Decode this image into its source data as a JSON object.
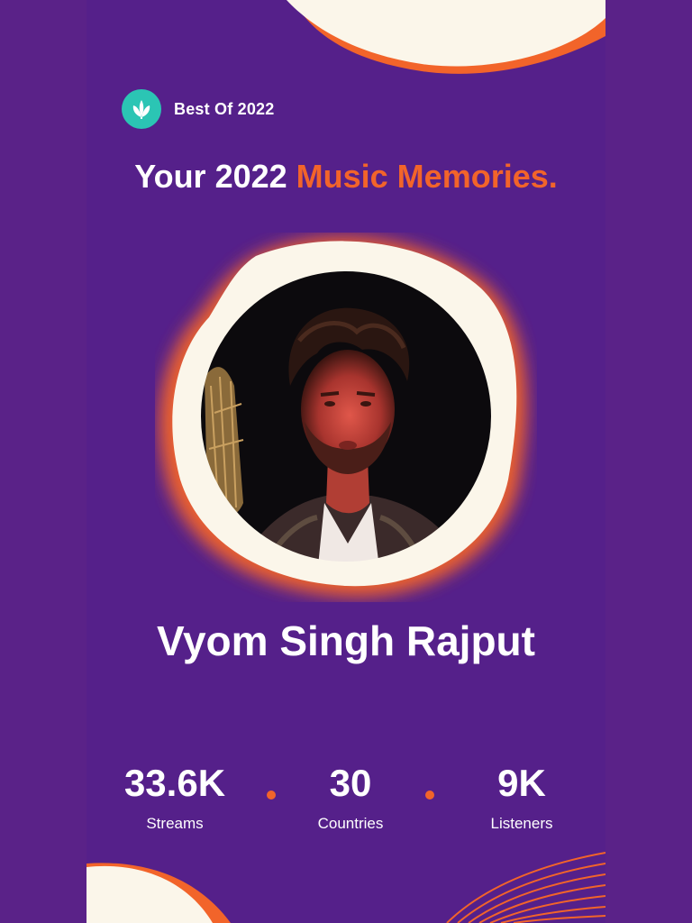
{
  "brand": {
    "label": "Best Of 2022",
    "icon": "saavn-leaf-icon",
    "logo_color": "#2bc5b4"
  },
  "headline": {
    "part1": "Your 2022 ",
    "part2": "Music Memories."
  },
  "artist": {
    "name": "Vyom Singh Rajput"
  },
  "stats": [
    {
      "value": "33.6K",
      "label": "Streams"
    },
    {
      "value": "30",
      "label": "Countries"
    },
    {
      "value": "9K",
      "label": "Listeners"
    }
  ],
  "colors": {
    "background": "#55208a",
    "accent": "#f2642a",
    "cream": "#fbf6ea",
    "text": "#ffffff"
  }
}
